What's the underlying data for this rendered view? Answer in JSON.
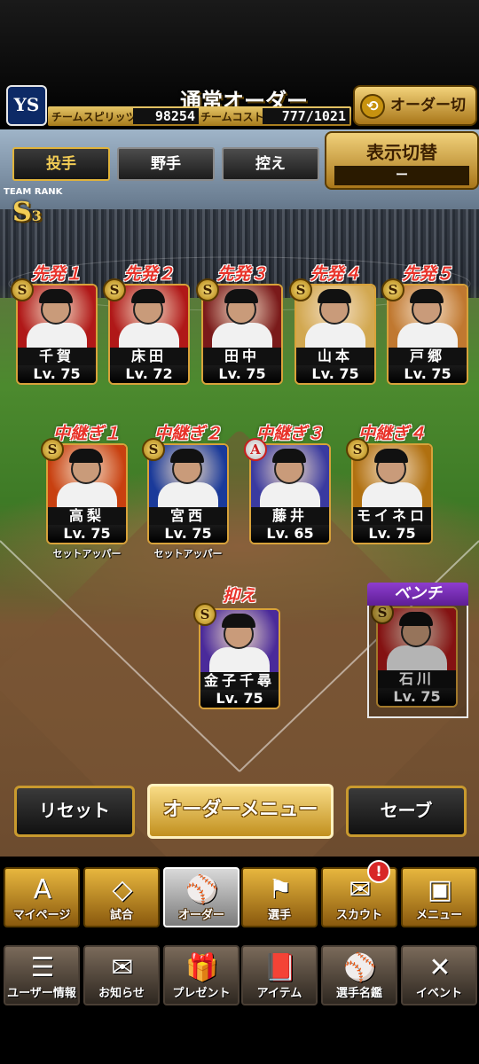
{
  "header": {
    "team_logo": "YS",
    "title": "通常オーダー",
    "team_spirits_label": "チームスピリッツ",
    "team_spirits_value": "98254",
    "team_cost_label": "チームコスト",
    "team_cost_value": "777/1021",
    "order_switch_label": "オーダー切替",
    "swap_icon": "⟲"
  },
  "tabs": [
    {
      "label": "投手",
      "active": true
    },
    {
      "label": "野手",
      "active": false
    },
    {
      "label": "控え",
      "active": false
    }
  ],
  "display_switch": {
    "label": "表示切替",
    "value": "ー"
  },
  "team_rank": {
    "label": "TEAM RANK",
    "rank": "S",
    "level": "3"
  },
  "starters": [
    {
      "slot": "先発１",
      "name": "千賀",
      "level": "Lv. 75",
      "badge": "S"
    },
    {
      "slot": "先発２",
      "name": "床田",
      "level": "Lv. 72",
      "badge": "S"
    },
    {
      "slot": "先発３",
      "name": "田中",
      "level": "Lv. 75",
      "badge": "S"
    },
    {
      "slot": "先発４",
      "name": "山本",
      "level": "Lv. 75",
      "badge": "S"
    },
    {
      "slot": "先発５",
      "name": "戸郷",
      "level": "Lv. 75",
      "badge": "S"
    }
  ],
  "relievers": [
    {
      "slot": "中継ぎ１",
      "name": "高梨",
      "level": "Lv. 75",
      "badge": "S",
      "role": "セットアッパー"
    },
    {
      "slot": "中継ぎ２",
      "name": "宮西",
      "level": "Lv. 75",
      "badge": "S",
      "role": "セットアッパー"
    },
    {
      "slot": "中継ぎ３",
      "name": "藤井",
      "level": "Lv. 65",
      "badge": "A",
      "role": ""
    },
    {
      "slot": "中継ぎ４",
      "name": "モイネロ",
      "level": "Lv. 75",
      "badge": "S",
      "role": ""
    }
  ],
  "closer": {
    "slot": "抑え",
    "name": "金子千尋",
    "level": "Lv. 75",
    "badge": "S"
  },
  "bench": {
    "slot": "ベンチ",
    "name": "石川",
    "level": "Lv. 75",
    "badge": "S"
  },
  "actions": {
    "reset": "リセット",
    "order_menu": "オーダーメニュー",
    "save": "セーブ"
  },
  "main_nav": [
    {
      "label": "マイページ",
      "icon": "A"
    },
    {
      "label": "試合",
      "icon": "◇"
    },
    {
      "label": "オーダー",
      "icon": "⚾"
    },
    {
      "label": "選手",
      "icon": "⚑"
    },
    {
      "label": "スカウト",
      "icon": "✉"
    },
    {
      "label": "メニュー",
      "icon": "▣"
    }
  ],
  "scout_notification": "!",
  "sub_nav": [
    {
      "label": "ユーザー情報",
      "icon": "☰"
    },
    {
      "label": "お知らせ",
      "icon": "✉"
    },
    {
      "label": "プレゼント",
      "icon": "🎁"
    },
    {
      "label": "アイテム",
      "icon": "📕"
    },
    {
      "label": "選手名鑑",
      "icon": "⚾"
    },
    {
      "label": "イベント",
      "icon": "✕"
    }
  ],
  "colors": {
    "gold": "#d8a23a",
    "slot_red": "#e8332a",
    "bench_purple": "#8e3dcf"
  }
}
